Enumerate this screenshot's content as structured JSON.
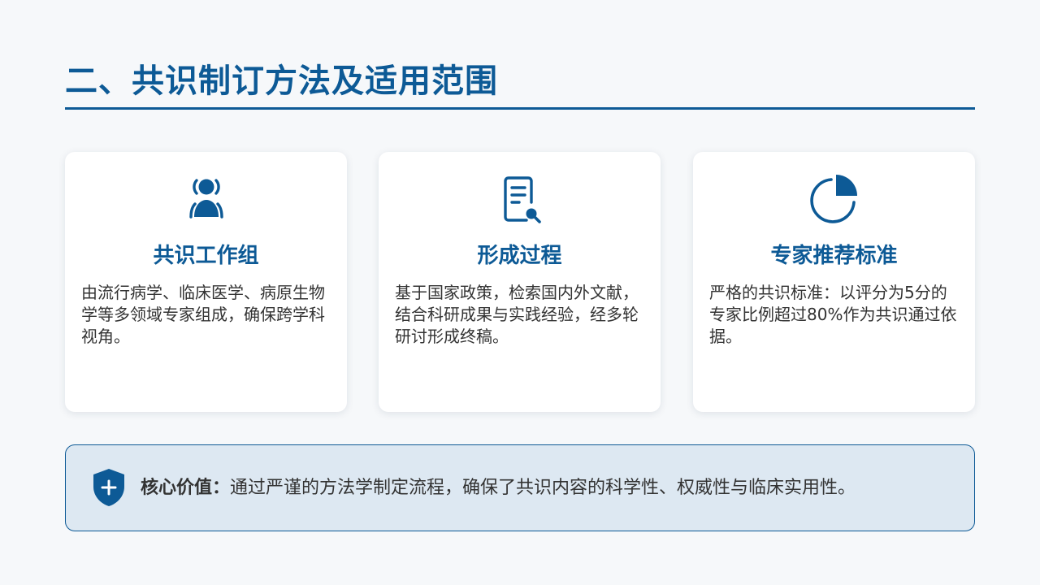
{
  "header": {
    "title": "二、共识制订方法及适用范围"
  },
  "cards": [
    {
      "icon": "experts-group-icon",
      "title": "共识工作组",
      "body": "由流行病学、临床医学、病原生物学等多领域专家组成，确保跨学科视角。"
    },
    {
      "icon": "document-search-icon",
      "title": "形成过程",
      "body": "基于国家政策，检索国内外文献，结合科研成果与实践经验，经多轮研讨形成终稿。"
    },
    {
      "icon": "pie-chart-icon",
      "title": "专家推荐标准",
      "body": "严格的共识标准：以评分为5分的专家比例超过80%作为共识通过依据。"
    }
  ],
  "callout": {
    "icon": "shield-plus-icon",
    "label": "核心价值：",
    "text": "通过严谨的方法学制定流程，确保了共识内容的科学性、权威性与临床实用性。"
  },
  "colors": {
    "primary": "#0d5a96",
    "background": "#f6f8fa",
    "card": "#ffffff",
    "callout_bg": "#dde8f2",
    "text": "#333333"
  }
}
